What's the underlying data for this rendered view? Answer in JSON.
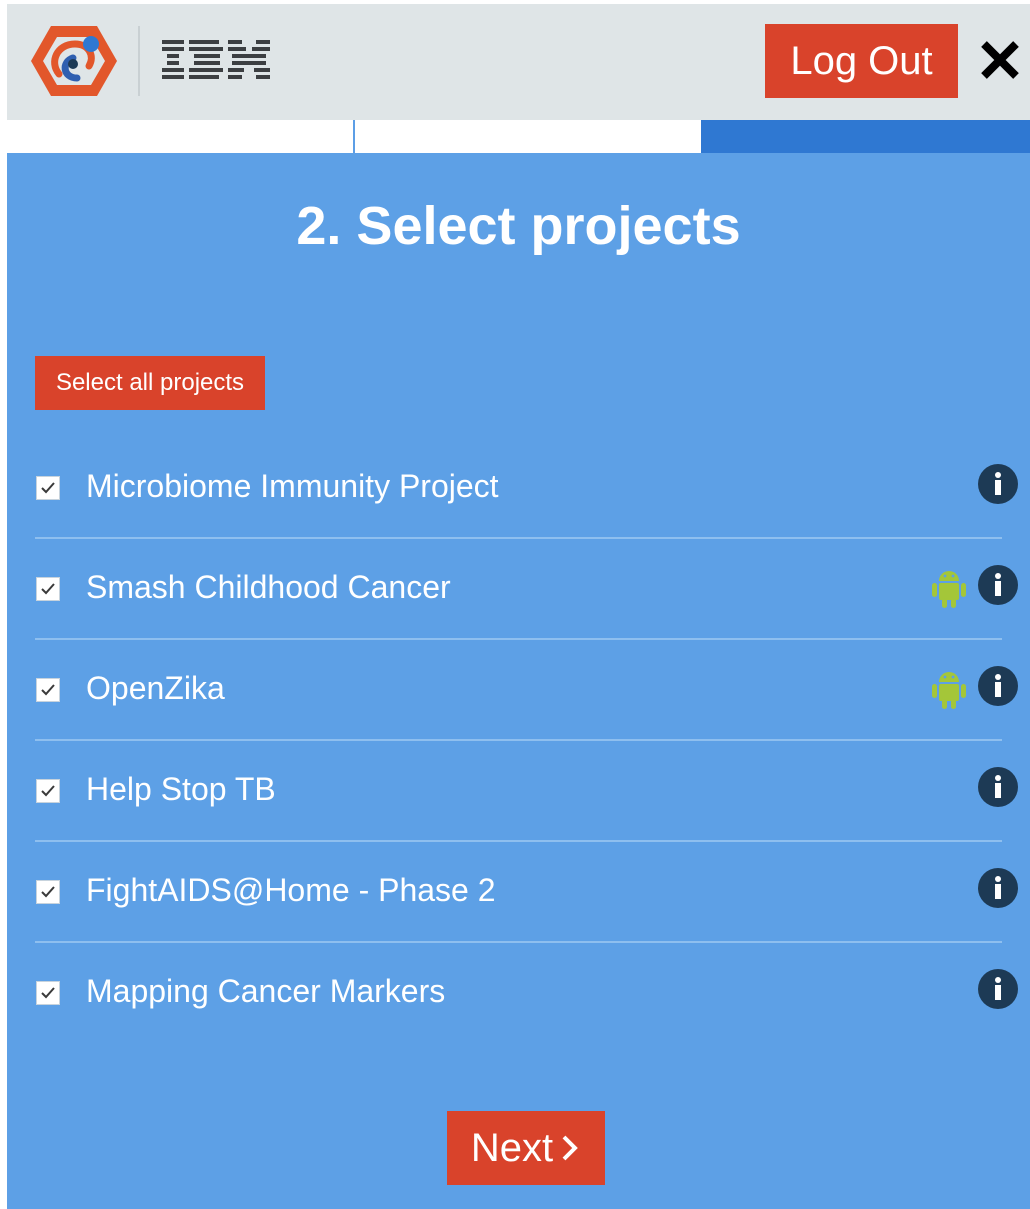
{
  "header": {
    "brand_text": "IBM",
    "logout_label": "Log Out"
  },
  "progress": {
    "current_step": 3,
    "total_steps": 3
  },
  "page": {
    "title": "2. Select projects",
    "select_all_label": "Select all projects",
    "next_label": "Next"
  },
  "projects": [
    {
      "name": "Microbiome Immunity Project",
      "checked": true,
      "android": false
    },
    {
      "name": "Smash Childhood Cancer",
      "checked": true,
      "android": true
    },
    {
      "name": "OpenZika",
      "checked": true,
      "android": true
    },
    {
      "name": "Help Stop TB",
      "checked": true,
      "android": false
    },
    {
      "name": "FightAIDS@Home - Phase 2",
      "checked": true,
      "android": false
    },
    {
      "name": "Mapping Cancer Markers",
      "checked": true,
      "android": false
    }
  ],
  "colors": {
    "accent_red": "#d9432b",
    "main_blue": "#5da0e6",
    "progress_blue": "#2f78d2",
    "header_gray": "#dfe5e7",
    "android_green": "#a4c639",
    "info_dark": "#1d3a55"
  },
  "icons": [
    "wcg-logo-icon",
    "ibm-logo-icon",
    "close-icon",
    "checkbox-checked-icon",
    "android-icon",
    "info-icon",
    "chevron-right-icon"
  ]
}
